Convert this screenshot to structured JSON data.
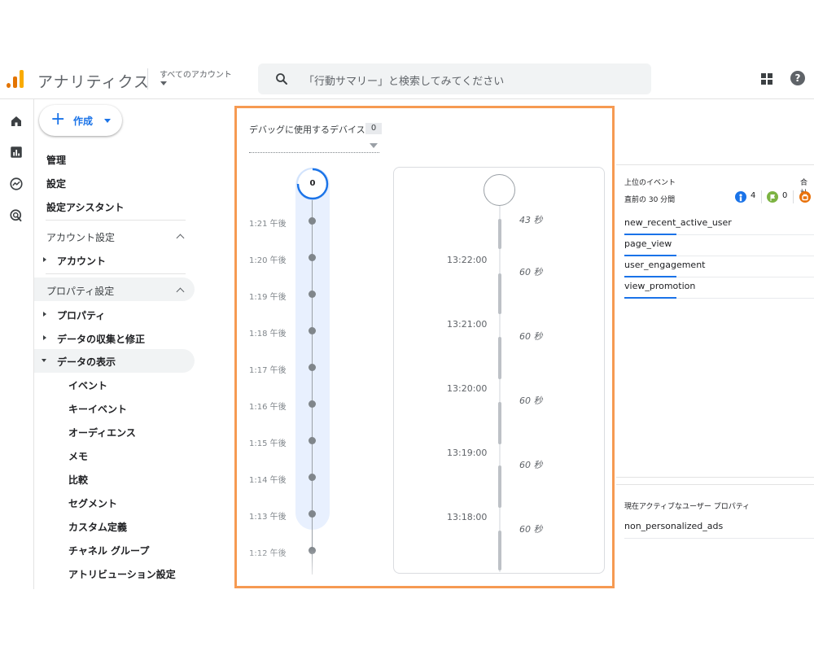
{
  "header": {
    "app_name": "アナリティクス",
    "account_selector": "すべてのアカウント",
    "search_placeholder": "「行動サマリー」と検索してみてください"
  },
  "rail": {
    "icons": [
      "home-icon",
      "reports-icon",
      "explore-icon",
      "advertising-icon"
    ]
  },
  "sidenav": {
    "create_label": "作成",
    "top_items": [
      "管理",
      "設定",
      "設定アシスタント"
    ],
    "account_section": {
      "title": "アカウント設定",
      "items": [
        "アカウント"
      ]
    },
    "property_section": {
      "title": "プロパティ設定",
      "items": [
        "プロパティ",
        "データの収集と修正",
        "データの表示"
      ],
      "expanded_item": "データの表示",
      "sub_items": [
        "イベント",
        "キーイベント",
        "オーディエンス",
        "メモ",
        "比較",
        "セグメント",
        "カスタム定義",
        "チャネル グループ",
        "アトリビューション設定"
      ]
    }
  },
  "debug": {
    "device_label": "デバッグに使用するデバイス",
    "device_count": "0",
    "minute_top_count": "0",
    "minute_labels": [
      "1:21 午後",
      "1:20 午後",
      "1:19 午後",
      "1:18 午後",
      "1:17 午後",
      "1:16 午後",
      "1:15 午後",
      "1:14 午後",
      "1:13 午後",
      "1:12 午後"
    ],
    "second_stamps": [
      "13:22:00",
      "13:21:00",
      "13:20:00",
      "13:19:00",
      "13:18:00"
    ],
    "durations": [
      "43 秒",
      "60 秒",
      "60 秒",
      "60 秒",
      "60 秒",
      "60 秒"
    ]
  },
  "top_events": {
    "title": "上位のイベント",
    "total_label": "合計",
    "subtitle": "直前の 30 分間",
    "badges": [
      {
        "icon": "info-icon",
        "count": "4",
        "color": "#1a73e8"
      },
      {
        "icon": "flag-icon",
        "count": "0",
        "color": "#7cb342"
      },
      {
        "icon": "alert-icon",
        "count": "",
        "color": "#e8710a"
      }
    ],
    "events": [
      "new_recent_active_user",
      "page_view",
      "user_engagement",
      "view_promotion"
    ]
  },
  "user_properties": {
    "title": "現在アクティブなユーザー プロパティ",
    "items": [
      "non_personalized_ads"
    ]
  }
}
